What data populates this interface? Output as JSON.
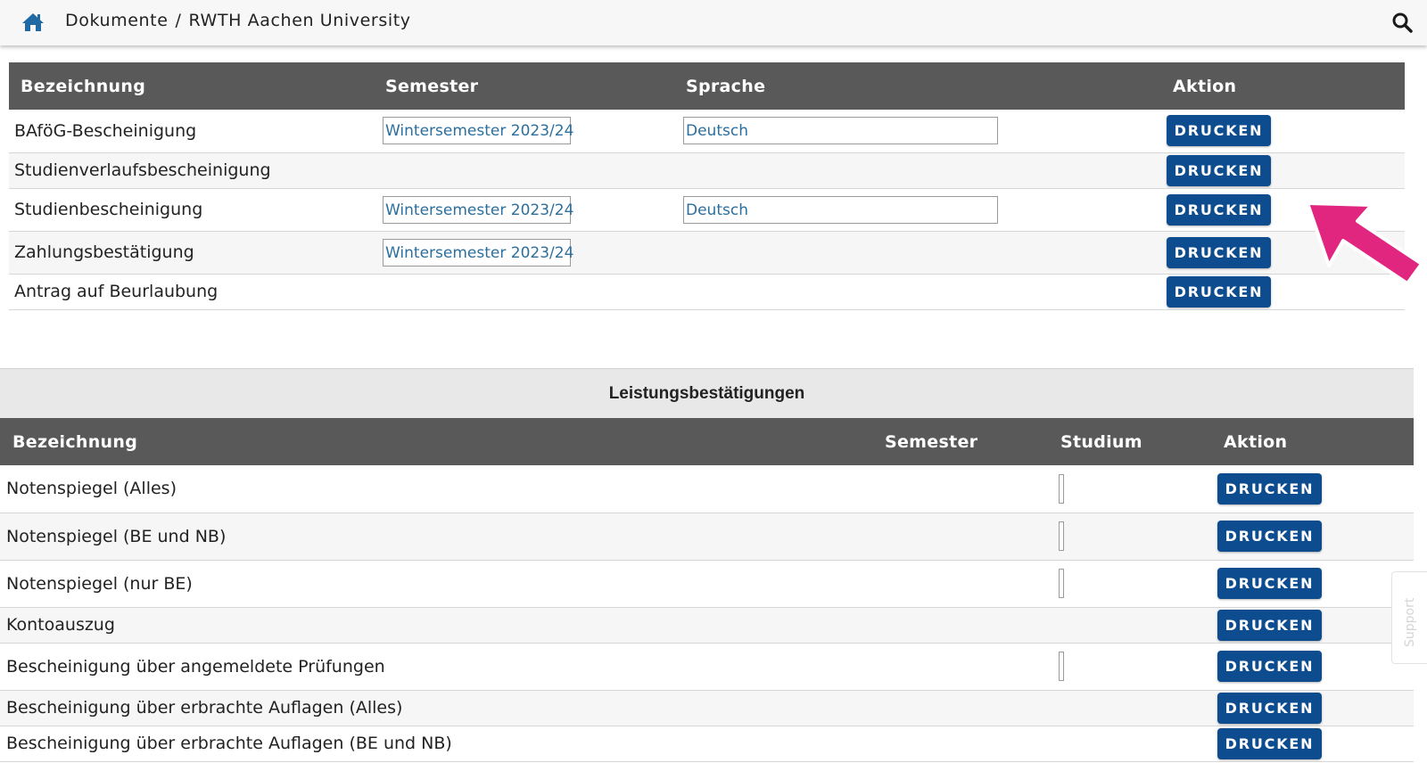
{
  "header": {
    "crumb_root": "Dokumente",
    "crumb_sep": "/",
    "crumb_current": "RWTH Aachen University"
  },
  "documents": {
    "columns": [
      "Bezeichnung",
      "Semester",
      "Sprache",
      "Aktion"
    ],
    "rows": [
      {
        "name": "BAföG-Bescheinigung",
        "semester": "Wintersemester 2023/24",
        "language": "Deutsch",
        "action": "DRUCKEN"
      },
      {
        "name": "Studienverlaufsbescheinigung",
        "action": "DRUCKEN"
      },
      {
        "name": "Studienbescheinigung",
        "semester": "Wintersemester 2023/24",
        "language": "Deutsch",
        "action": "DRUCKEN"
      },
      {
        "name": "Zahlungsbestätigung",
        "semester": "Wintersemester 2023/24",
        "action": "DRUCKEN"
      },
      {
        "name": "Antrag auf Beurlaubung",
        "action": "DRUCKEN"
      }
    ]
  },
  "achievements": {
    "section_title": "Leistungsbestätigungen",
    "columns": [
      "Bezeichnung",
      "Semester",
      "Studium",
      "Aktion"
    ],
    "rows": [
      {
        "name": "Notenspiegel (Alles)",
        "action": "DRUCKEN"
      },
      {
        "name": "Notenspiegel (BE und NB)",
        "action": "DRUCKEN"
      },
      {
        "name": "Notenspiegel (nur BE)",
        "action": "DRUCKEN"
      },
      {
        "name": "Kontoauszug",
        "action": "DRUCKEN"
      },
      {
        "name": "Bescheinigung über angemeldete Prüfungen",
        "action": "DRUCKEN"
      },
      {
        "name": "Bescheinigung über erbrachte Auflagen (Alles)",
        "action": "DRUCKEN"
      },
      {
        "name": "Bescheinigung über erbrachte Auflagen (BE und NB)",
        "action": "DRUCKEN"
      }
    ]
  },
  "support": {
    "label": "Support"
  },
  "colors": {
    "primary_button": "#0d4d8f",
    "header_row": "#595959",
    "select_text": "#2a6f9e",
    "annotation_arrow": "#e0267f"
  },
  "icons": {
    "home": "home-icon",
    "search": "search-icon",
    "arrow": "pointer-arrow-icon"
  }
}
